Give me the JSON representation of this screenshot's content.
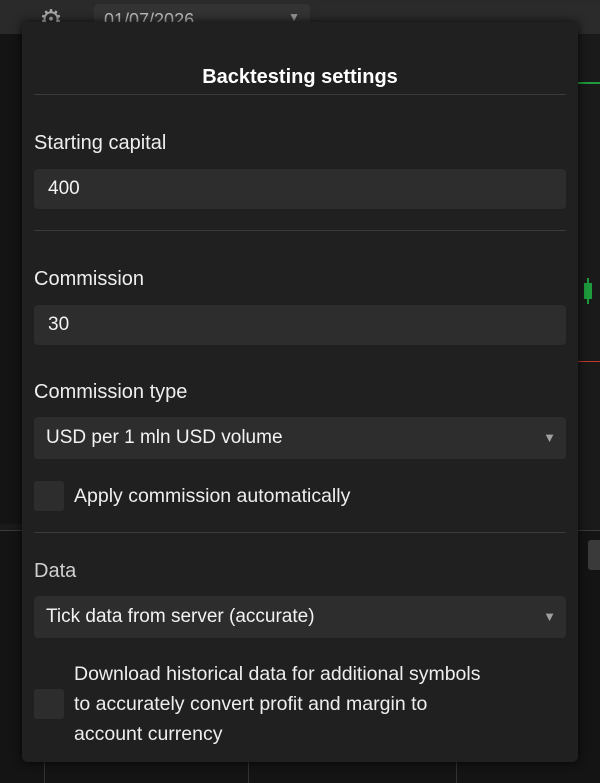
{
  "background": {
    "date_value": "01/07/2026",
    "gear_icon": "gear-icon"
  },
  "dialog": {
    "title": "Backtesting settings",
    "starting_capital": {
      "label": "Starting capital",
      "value": "400"
    },
    "commission": {
      "label": "Commission",
      "value": "30"
    },
    "commission_type": {
      "label": "Commission type",
      "selected": "USD per 1 mln USD volume"
    },
    "apply_commission": {
      "label": "Apply commission automatically",
      "checked": false
    },
    "data": {
      "label": "Data",
      "selected": "Tick data from server (accurate)"
    },
    "download_historical": {
      "label_lines": [
        "Download historical data for additional symbols",
        "to accurately convert profit and margin to",
        "account currency"
      ],
      "checked": false
    }
  },
  "colors": {
    "dialog_bg": "#202020",
    "field_bg": "#2d2d2d",
    "text": "#eeeeee",
    "accent_green": "#1e9b3c",
    "accent_red": "#c0392b"
  }
}
